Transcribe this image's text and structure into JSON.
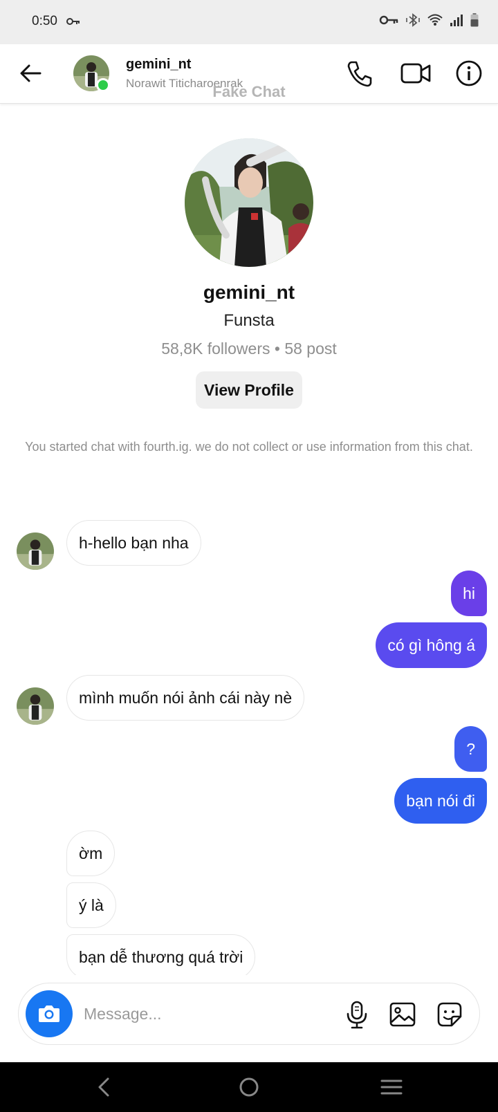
{
  "status_bar": {
    "time": "0:50"
  },
  "header": {
    "name": "gemini_nt",
    "subtitle": "Norawit Titicharoenrak",
    "watermark": "Fake Chat"
  },
  "profile": {
    "name": "gemini_nt",
    "kind": "Funsta",
    "stats": "58,8K followers • 58 post",
    "view_profile_label": "View Profile",
    "notice": "You started chat with fourth.ig. we do not collect or use information from this chat."
  },
  "messages": [
    {
      "side": "in",
      "text": "h-hello bạn nha"
    },
    {
      "side": "out",
      "text": "hi"
    },
    {
      "side": "out",
      "text": "có gì hông á"
    },
    {
      "side": "in",
      "text": "mình muốn nói ảnh cái này nè"
    },
    {
      "side": "out",
      "text": "?"
    },
    {
      "side": "out",
      "text": "bạn nói đi"
    },
    {
      "side": "in",
      "text": "ờm"
    },
    {
      "side": "in",
      "text": "ý là"
    },
    {
      "side": "in",
      "text": "bạn dễ thương quá trời"
    }
  ],
  "composer": {
    "placeholder": "Message..."
  },
  "colors": {
    "online": "#2ecc4a",
    "camera_button": "#1877f2",
    "out_bubble_top": "#6a3fe8",
    "out_bubble_bottom": "#2f5ff0"
  },
  "icons": {
    "header": [
      "back-arrow-icon",
      "phone-icon",
      "video-call-icon",
      "info-icon"
    ],
    "composer": [
      "camera-icon",
      "microphone-icon",
      "image-icon",
      "sticker-icon"
    ],
    "nav": [
      "nav-back-icon",
      "nav-home-icon",
      "nav-recents-icon"
    ]
  }
}
